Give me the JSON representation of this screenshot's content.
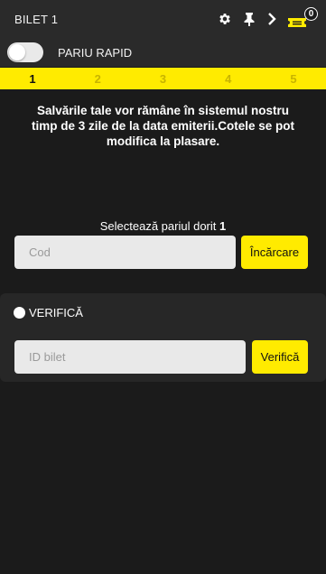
{
  "header": {
    "title": "BILET 1",
    "ticket_count": "0",
    "icons": [
      "gear-icon",
      "pin-icon",
      "chevron-right-icon",
      "ticket-icon"
    ]
  },
  "quick_bet": {
    "label": "PARIU RAPID",
    "enabled": false
  },
  "steps": {
    "items": [
      "1",
      "2",
      "3",
      "4",
      "5"
    ],
    "active": "1"
  },
  "load_panel": {
    "info": "Salvările tale vor rămâne în sistemul nostru timp de 3 zile de la data emiterii.Cotele se pot modifica la plasare.",
    "select_label": "Selectează pariul dorit",
    "select_number": "1",
    "code_placeholder": "Cod",
    "load_button": "Încărcare"
  },
  "verify_panel": {
    "radio_label": "VERIFICĂ",
    "ticket_placeholder": "ID bilet",
    "verify_button": "Verifică"
  },
  "colors": {
    "accent": "#ffeb00",
    "background": "#1b1b1b",
    "panel": "#2a2a2a"
  }
}
